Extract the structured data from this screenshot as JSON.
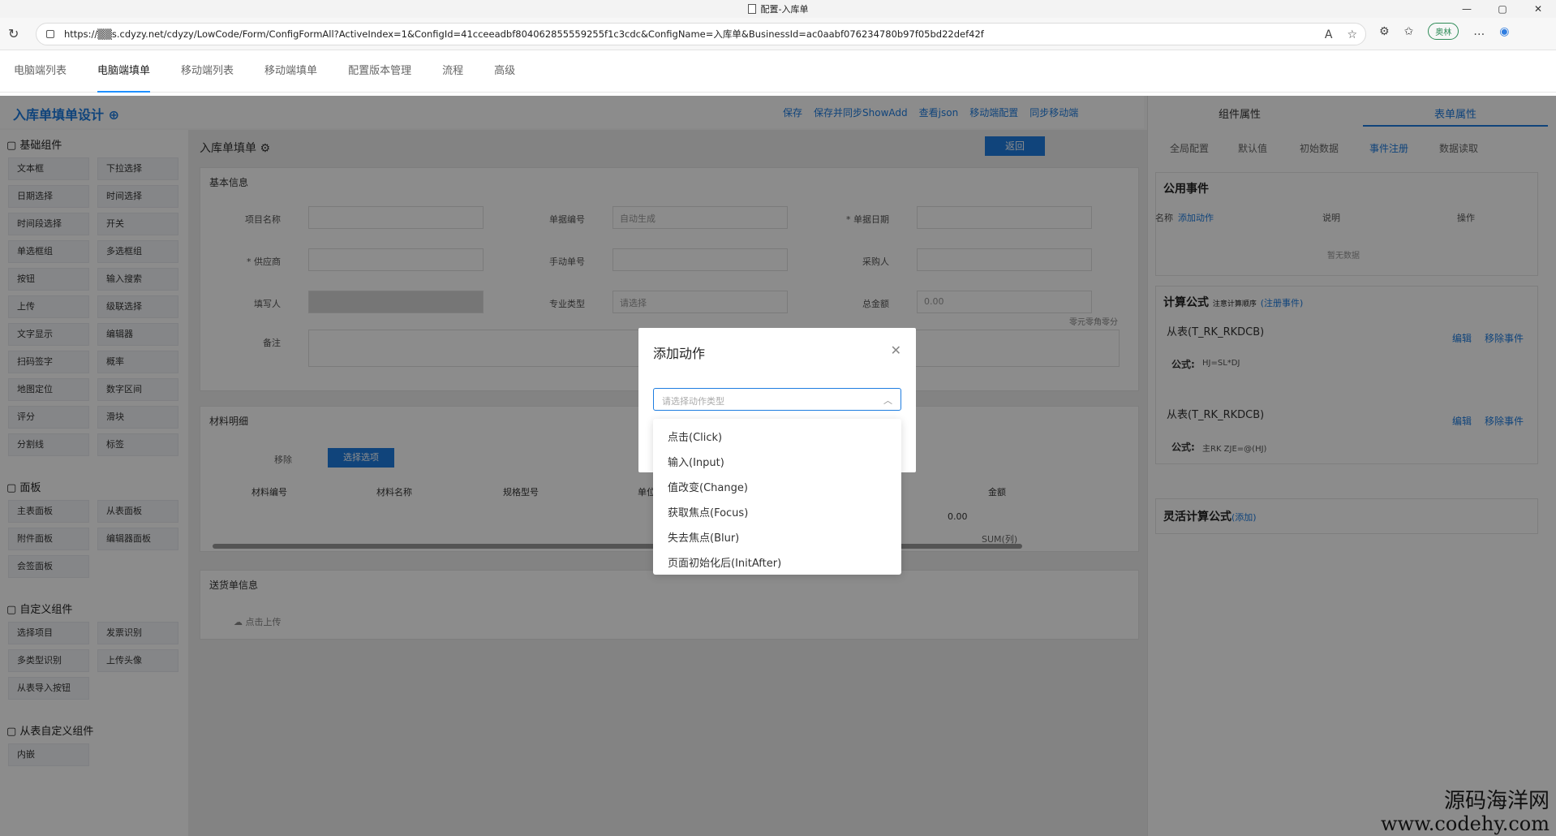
{
  "window": {
    "title": "配置-入库单",
    "controls": [
      "—",
      "▢",
      "✕"
    ]
  },
  "browser": {
    "url": "https://▒▒s.cdyzy.net/cdyzy/LowCode/Form/ConfigFormAll?ActiveIndex=1&ConfigId=41cceeadbf804062855559255f1c3cdc&ConfigName=入库单&BusinessId=ac0aabf076234780b97f05bd22def42f",
    "reading_label": "A",
    "pill_label": "奥林"
  },
  "top_tabs": [
    "电脑端列表",
    "电脑端填单",
    "移动端列表",
    "移动端填单",
    "配置版本管理",
    "流程",
    "高级"
  ],
  "designer": {
    "title": "入库单填单设计",
    "actions": [
      "保存",
      "保存并同步ShowAdd",
      "查看json",
      "移动端配置",
      "同步移动端"
    ]
  },
  "left_panel": {
    "groups": [
      {
        "title": "基础组件",
        "items": [
          "文本框",
          "下拉选择",
          "日期选择",
          "时间选择",
          "时间段选择",
          "开关",
          "单选框组",
          "多选框组",
          "按钮",
          "输入搜索",
          "上传",
          "级联选择",
          "文字显示",
          "编辑器",
          "扫码签字",
          "概率",
          "地图定位",
          "数字区间",
          "评分",
          "滑块",
          "分割线",
          "标签"
        ]
      },
      {
        "title": "面板",
        "items": [
          "主表面板",
          "从表面板",
          "附件面板",
          "编辑器面板",
          "会签面板"
        ]
      },
      {
        "title": "自定义组件",
        "items": [
          "选择项目",
          "发票识别",
          "多类型识别",
          "上传头像",
          "从表导入按钮"
        ]
      },
      {
        "title": "从表自定义组件",
        "items": [
          "内嵌"
        ]
      }
    ]
  },
  "canvas": {
    "form_title": "入库单填单",
    "return_label": "返回",
    "basic_info": {
      "title": "基本信息",
      "fields": [
        {
          "label": "项目名称",
          "value": ""
        },
        {
          "label": "单据编号",
          "value": "自动生成"
        },
        {
          "label": "* 单据日期",
          "value": ""
        },
        {
          "label": "* 供应商",
          "value": ""
        },
        {
          "label": "手动单号",
          "value": ""
        },
        {
          "label": "采购人",
          "value": ""
        },
        {
          "label": "填写人",
          "value": ""
        },
        {
          "label": "专业类型",
          "value": "请选择"
        },
        {
          "label": "总金额",
          "value": "0.00"
        },
        {
          "label": "备注",
          "value": ""
        }
      ],
      "hint": "零元零角零分"
    },
    "materials": {
      "title": "材料明细",
      "btn_remove": "移除",
      "btn_select": "选择选项",
      "headers": [
        "材料编号",
        "材料名称",
        "规格型号",
        "单位",
        "金额"
      ],
      "row_value": "0.00",
      "sum_label": "SUM(列)",
      "dash": "-"
    },
    "delivery": {
      "title": "送货单信息",
      "upload": "点击上传"
    }
  },
  "right_panel": {
    "tabs": [
      "组件属性",
      "表单属性"
    ],
    "subtabs": [
      "全局配置",
      "默认值",
      "初始数据",
      "事件注册",
      "数据读取"
    ],
    "public_events": {
      "title": "公用事件",
      "cols": [
        "名称",
        "添加动作",
        "说明",
        "操作"
      ],
      "empty": "暂无数据"
    },
    "formula": {
      "title": "计算公式",
      "note": "注意计算顺序",
      "register": "(注册事件)",
      "entries": [
        {
          "table": "从表(T_RK_RKDCB)",
          "edit": "编辑",
          "remove": "移除事件",
          "formula_label": "公式:",
          "formula": "HJ=SL*DJ"
        },
        {
          "table": "从表(T_RK_RKDCB)",
          "edit": "编辑",
          "remove": "移除事件",
          "formula_label": "公式:",
          "formula": "主RK ZJE=@(HJ)"
        }
      ]
    },
    "flex_formula": {
      "title": "灵活计算公式",
      "add": "(添加)"
    }
  },
  "modal": {
    "title": "添加动作",
    "placeholder": "请选择动作类型",
    "options": [
      "点击(Click)",
      "输入(Input)",
      "值改变(Change)",
      "获取焦点(Focus)",
      "失去焦点(Blur)",
      "页面初始化后(InitAfter)"
    ]
  },
  "watermark": {
    "cn": "源码海洋网",
    "en": "www.codehy.com"
  },
  "colors": {
    "accent": "#1e7de0",
    "danger": "#e05a5a",
    "mask": "rgba(0,0,0,0.45)"
  }
}
